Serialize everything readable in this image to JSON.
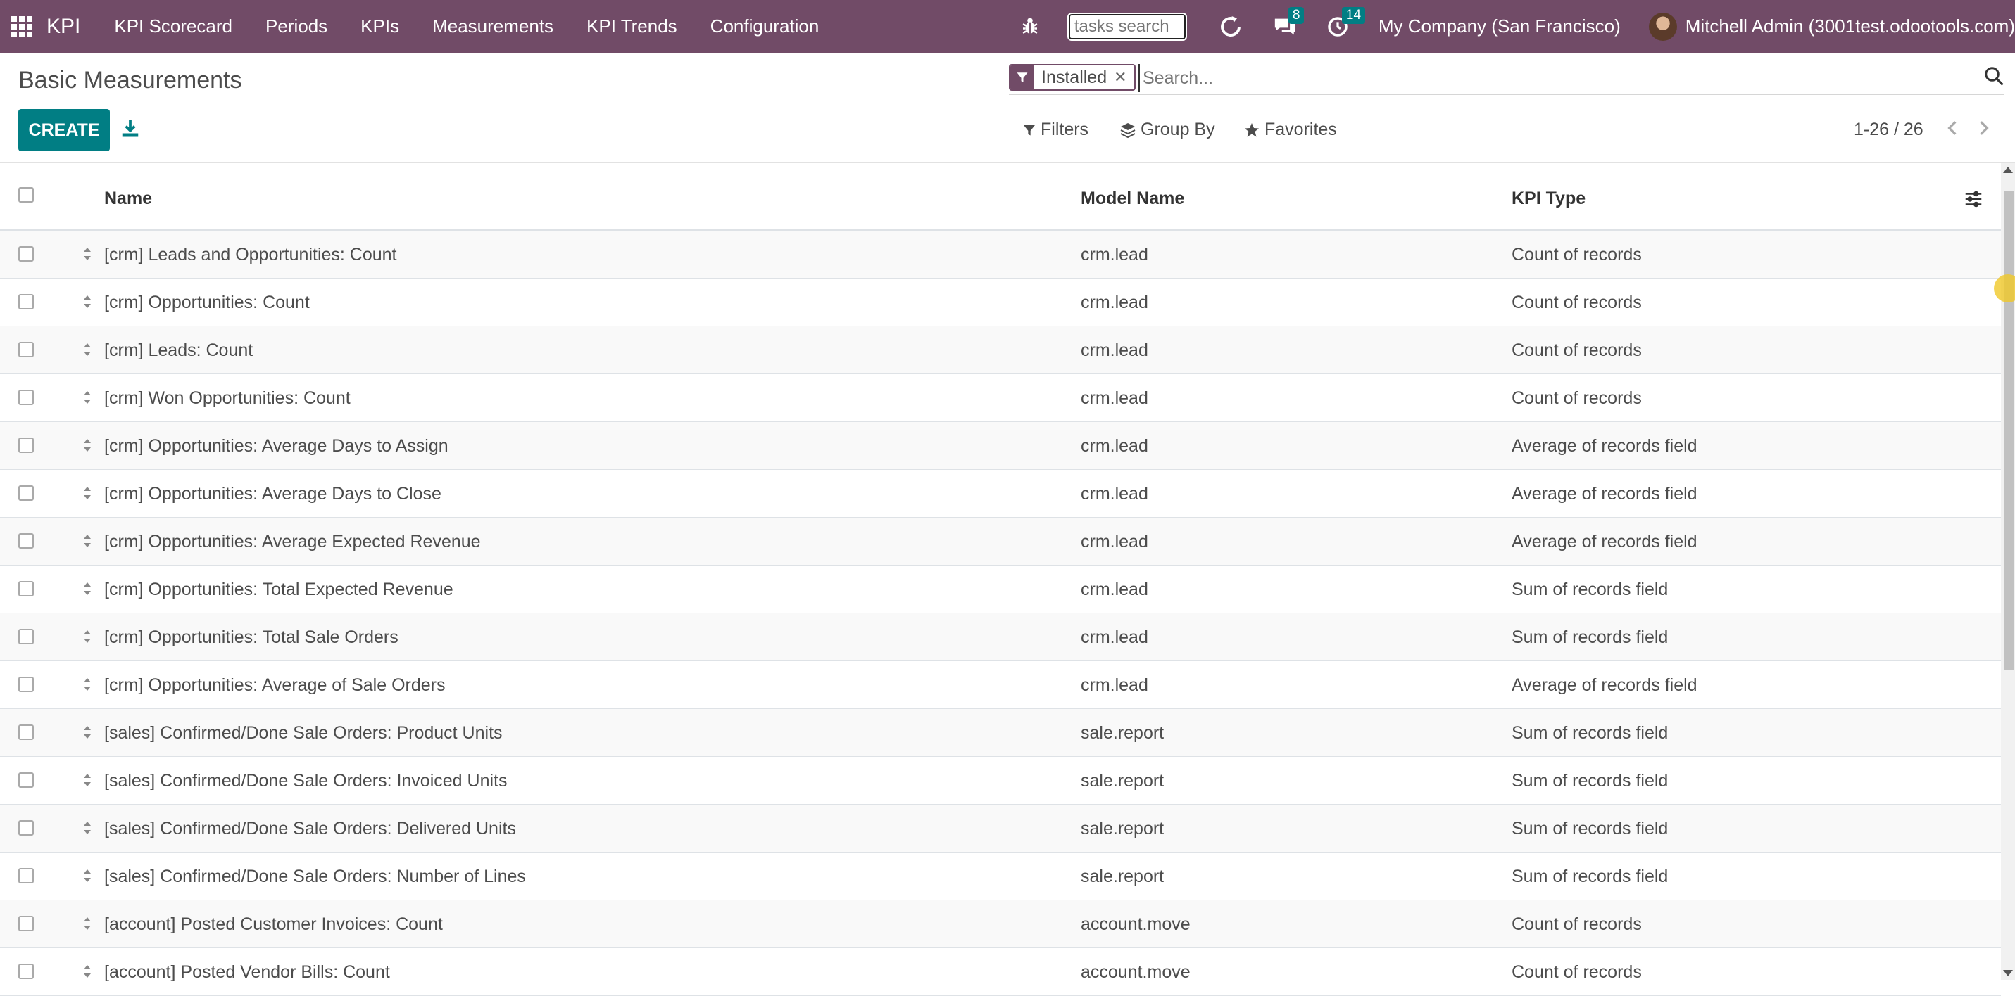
{
  "navbar": {
    "brand": "KPI",
    "menu": [
      "KPI Scorecard",
      "Periods",
      "KPIs",
      "Measurements",
      "KPI Trends",
      "Configuration"
    ],
    "tasks_search_placeholder": "tasks search",
    "messages_count": "8",
    "activities_count": "14",
    "company": "My Company (San Francisco)",
    "user": "Mitchell Admin (3001test.odootools.com)"
  },
  "control": {
    "title": "Basic Measurements",
    "create_label": "CREATE",
    "facet_label": "Installed",
    "search_placeholder": "Search...",
    "filters_label": "Filters",
    "groupby_label": "Group By",
    "favorites_label": "Favorites",
    "pager": "1-26 / 26"
  },
  "table": {
    "headers": {
      "name": "Name",
      "model": "Model Name",
      "type": "KPI Type"
    },
    "rows": [
      {
        "name": "[crm] Leads and Opportunities: Count",
        "model": "crm.lead",
        "type": "Count of records"
      },
      {
        "name": "[crm] Opportunities: Count",
        "model": "crm.lead",
        "type": "Count of records"
      },
      {
        "name": "[crm] Leads: Count",
        "model": "crm.lead",
        "type": "Count of records"
      },
      {
        "name": "[crm] Won Opportunities: Count",
        "model": "crm.lead",
        "type": "Count of records"
      },
      {
        "name": "[crm] Opportunities: Average Days to Assign",
        "model": "crm.lead",
        "type": "Average of records field"
      },
      {
        "name": "[crm] Opportunities: Average Days to Close",
        "model": "crm.lead",
        "type": "Average of records field"
      },
      {
        "name": "[crm] Opportunities: Average Expected Revenue",
        "model": "crm.lead",
        "type": "Average of records field"
      },
      {
        "name": "[crm] Opportunities: Total Expected Revenue",
        "model": "crm.lead",
        "type": "Sum of records field"
      },
      {
        "name": "[crm] Opportunities: Total Sale Orders",
        "model": "crm.lead",
        "type": "Sum of records field"
      },
      {
        "name": "[crm] Opportunities: Average of Sale Orders",
        "model": "crm.lead",
        "type": "Average of records field"
      },
      {
        "name": "[sales] Confirmed/Done Sale Orders: Product Units",
        "model": "sale.report",
        "type": "Sum of records field"
      },
      {
        "name": "[sales] Confirmed/Done Sale Orders: Invoiced Units",
        "model": "sale.report",
        "type": "Sum of records field"
      },
      {
        "name": "[sales] Confirmed/Done Sale Orders: Delivered Units",
        "model": "sale.report",
        "type": "Sum of records field"
      },
      {
        "name": "[sales] Confirmed/Done Sale Orders: Number of Lines",
        "model": "sale.report",
        "type": "Sum of records field"
      },
      {
        "name": "[account] Posted Customer Invoices: Count",
        "model": "account.move",
        "type": "Count of records"
      },
      {
        "name": "[account] Posted Vendor Bills: Count",
        "model": "account.move",
        "type": "Count of records"
      }
    ]
  },
  "colors": {
    "navbar": "#714b67",
    "primary": "#017e84",
    "badge": "#017e84"
  }
}
